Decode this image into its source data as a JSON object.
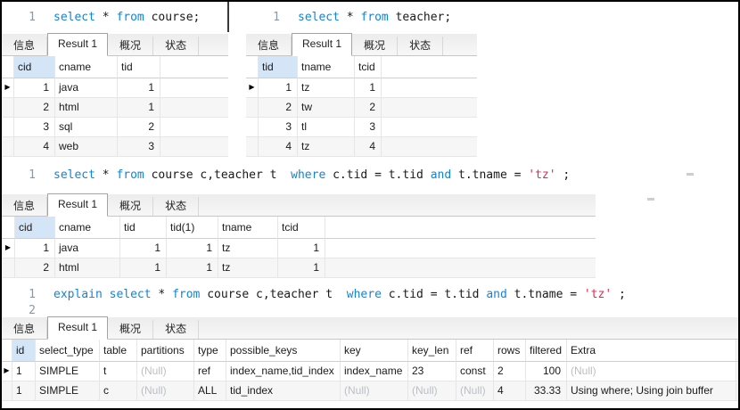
{
  "colors": {
    "keyword": "#0e85dc",
    "string": "#e02b50",
    "line_number": "#8b98a5",
    "null_value": "#b9bfc7",
    "header_highlight": "#d3e5f7",
    "grid_line": "#e6e6e6"
  },
  "icons": {
    "row_marker": "▶"
  },
  "panels": {
    "course": {
      "query": {
        "line1": "1",
        "tokens": [
          {
            "c": "kw",
            "t": "select"
          },
          {
            "c": "tx",
            "t": " * "
          },
          {
            "c": "kw",
            "t": "from"
          },
          {
            "c": "tx",
            "t": " course;"
          }
        ]
      },
      "tabs": [
        "信息",
        "Result 1",
        "概况",
        "状态"
      ],
      "active_tab": "Result 1",
      "table": {
        "columns": [
          "cid",
          "cname",
          "tid"
        ],
        "rows": [
          [
            "1",
            "java",
            "1"
          ],
          [
            "2",
            "html",
            "1"
          ],
          [
            "3",
            "sql",
            "2"
          ],
          [
            "4",
            "web",
            "3"
          ]
        ]
      }
    },
    "teacher": {
      "query": {
        "line1": "1",
        "tokens": [
          {
            "c": "kw",
            "t": "select"
          },
          {
            "c": "tx",
            "t": " * "
          },
          {
            "c": "kw",
            "t": "from"
          },
          {
            "c": "tx",
            "t": " teacher;"
          }
        ]
      },
      "tabs": [
        "信息",
        "Result 1",
        "概况",
        "状态"
      ],
      "active_tab": "Result 1",
      "table": {
        "columns": [
          "tid",
          "tname",
          "tcid"
        ],
        "rows": [
          [
            "1",
            "tz",
            "1"
          ],
          [
            "2",
            "tw",
            "2"
          ],
          [
            "3",
            "tl",
            "3"
          ],
          [
            "4",
            "tz",
            "4"
          ]
        ]
      }
    },
    "join": {
      "query": {
        "line1": "1",
        "tokens": [
          {
            "c": "kw",
            "t": "select"
          },
          {
            "c": "tx",
            "t": " * "
          },
          {
            "c": "kw",
            "t": "from"
          },
          {
            "c": "tx",
            "t": " course c,teacher t  "
          },
          {
            "c": "kw",
            "t": "where"
          },
          {
            "c": "tx",
            "t": " c.tid = t.tid "
          },
          {
            "c": "kw",
            "t": "and"
          },
          {
            "c": "tx",
            "t": " t.tname = "
          },
          {
            "c": "str",
            "t": "'tz'"
          },
          {
            "c": "tx",
            "t": " ;"
          }
        ]
      },
      "tabs": [
        "信息",
        "Result 1",
        "概况",
        "状态"
      ],
      "active_tab": "Result 1",
      "table": {
        "columns": [
          "cid",
          "cname",
          "tid",
          "tid(1)",
          "tname",
          "tcid"
        ],
        "rows": [
          [
            "1",
            "java",
            "1",
            "1",
            "tz",
            "1"
          ],
          [
            "2",
            "html",
            "1",
            "1",
            "tz",
            "1"
          ]
        ]
      }
    },
    "explain": {
      "query": {
        "line1": "1",
        "line2": "2",
        "tokens": [
          {
            "c": "kw",
            "t": "explain"
          },
          {
            "c": "tx",
            "t": " "
          },
          {
            "c": "kw",
            "t": "select"
          },
          {
            "c": "tx",
            "t": " * "
          },
          {
            "c": "kw",
            "t": "from"
          },
          {
            "c": "tx",
            "t": " course c,teacher t  "
          },
          {
            "c": "kw",
            "t": "where"
          },
          {
            "c": "tx",
            "t": " c.tid = t.tid "
          },
          {
            "c": "kw",
            "t": "and"
          },
          {
            "c": "tx",
            "t": " t.tname = "
          },
          {
            "c": "str",
            "t": "'tz'"
          },
          {
            "c": "tx",
            "t": " ;"
          }
        ]
      },
      "tabs": [
        "信息",
        "Result 1",
        "概况",
        "状态"
      ],
      "active_tab": "Result 1",
      "table": {
        "columns": [
          "id",
          "select_type",
          "table",
          "partitions",
          "type",
          "possible_keys",
          "key",
          "key_len",
          "ref",
          "rows",
          "filtered",
          "Extra"
        ],
        "rows": [
          [
            "1",
            "SIMPLE",
            "t",
            "(Null)",
            "ref",
            "index_name,tid_index",
            "index_name",
            "23",
            "const",
            "2",
            "100",
            "(Null)"
          ],
          [
            "1",
            "SIMPLE",
            "c",
            "(Null)",
            "ALL",
            "tid_index",
            "(Null)",
            "(Null)",
            "(Null)",
            "4",
            "33.33",
            "Using where; Using join buffer"
          ]
        ]
      }
    }
  }
}
